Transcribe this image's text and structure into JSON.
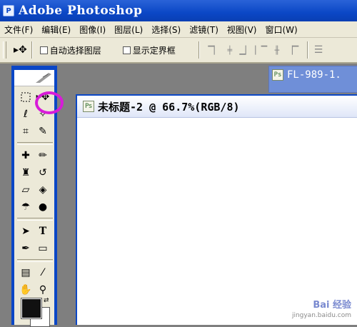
{
  "app": {
    "title": "Adobe Photoshop",
    "icon": "photoshop-icon"
  },
  "menu": [
    "文件(F)",
    "编辑(E)",
    "图像(I)",
    "图层(L)",
    "选择(S)",
    "滤镜(T)",
    "视图(V)",
    "窗口(W)"
  ],
  "options": {
    "tool_icon": "move-tool-icon",
    "auto_select": "自动选择图层",
    "show_bounds": "显示定界框"
  },
  "toolbox": {
    "rows": [
      [
        "marquee-tool-icon",
        "move-tool-icon"
      ],
      [
        "lasso-tool-icon",
        "magic-wand-icon"
      ],
      [
        "crop-tool-icon",
        "slice-tool-icon"
      ],
      [
        "healing-brush-icon",
        "brush-tool-icon"
      ],
      [
        "clone-stamp-icon",
        "history-brush-icon"
      ],
      [
        "eraser-tool-icon",
        "paint-bucket-icon"
      ],
      [
        "blur-tool-icon",
        "dodge-tool-icon"
      ],
      [
        "path-select-icon",
        "type-tool-icon"
      ],
      [
        "pen-tool-icon",
        "shape-tool-icon"
      ],
      [
        "notes-tool-icon",
        "eyedropper-icon"
      ],
      [
        "hand-tool-icon",
        "zoom-tool-icon"
      ]
    ],
    "highlight_color": "#d81cd8"
  },
  "documents": {
    "back": {
      "title": "FL-989-1."
    },
    "front": {
      "title": "未标题-2 @ 66.7%(RGB/8)"
    }
  },
  "watermark": {
    "line1": "Bai 经验",
    "line2": "jingyan.baidu.com"
  }
}
